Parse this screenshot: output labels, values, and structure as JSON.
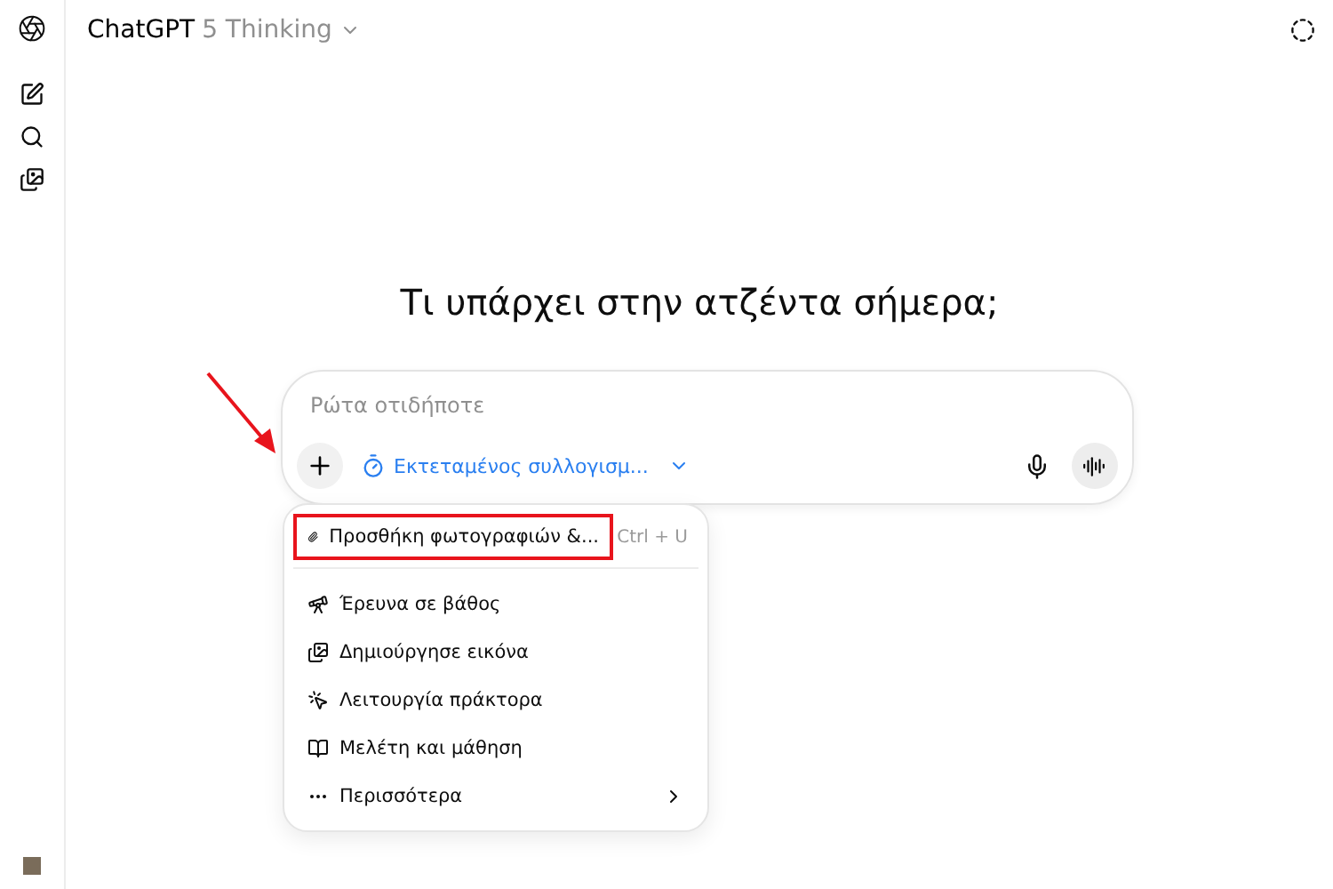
{
  "header": {
    "brand": "ChatGPT",
    "model": "5 Thinking"
  },
  "heading": "Τι υπάρχει στην ατζέντα σήμερα;",
  "composer": {
    "placeholder": "Ρώτα οτιδήποτε",
    "mode": "Εκτεταμένος συλλογισμ..."
  },
  "menu": [
    {
      "kind": "attach",
      "label": "Προσθήκη φωτογραφιών &...",
      "shortcut": "Ctrl + U",
      "highlighted": true
    },
    {
      "kind": "research",
      "label": "Έρευνα σε βάθος",
      "highlighted": false
    },
    {
      "kind": "image",
      "label": "Δημιούργησε εικόνα",
      "highlighted": false
    },
    {
      "kind": "agent",
      "label": "Λειτουργία πράκτορα",
      "highlighted": false
    },
    {
      "kind": "study",
      "label": "Μελέτη και μάθηση",
      "highlighted": false
    },
    {
      "kind": "more",
      "label": "Περισσότερα",
      "highlighted": false
    }
  ]
}
